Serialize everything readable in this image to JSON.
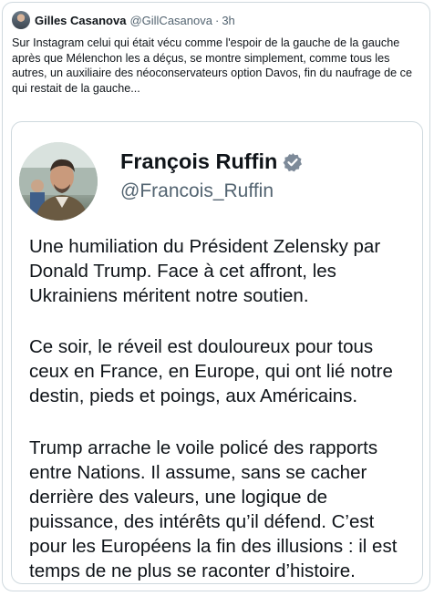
{
  "tweet": {
    "author": {
      "name": "Gilles Casanova",
      "handle": "@GillCasanova",
      "separator": "·",
      "time": "3h"
    },
    "text_lines": [
      "Sur Instagram celui qui était vécu comme l'espoir de la gauche de la gauche",
      "après que Mélenchon les a déçus, se montre simplement, comme tous les",
      "autres, un auxiliaire des néoconservateurs option Davos, fin du naufrage de ce",
      "qui restait de la gauche..."
    ]
  },
  "embedded_post": {
    "name": "François Ruffin",
    "handle": "@Francois_Ruffin",
    "verified_color": "#7d8a99",
    "paragraphs": [
      {
        "lines": [
          "Une humiliation du Président Zelensky par",
          "Donald Trump. Face à cet affront, les",
          "Ukrainiens méritent notre soutien."
        ]
      },
      {
        "lines": [
          "Ce soir, le réveil est douloureux pour tous",
          "ceux en France, en Europe, qui ont lié notre",
          "destin, pieds et poings, aux Américains."
        ]
      },
      {
        "lines": [
          "Trump arrache le voile policé des rapports",
          "entre Nations. Il assume, sans se cacher",
          "derrière des valeurs, une logique de",
          "puissance, des intérêts qu’il défend. C’est",
          "pour les Européens la fin des illusions : il est",
          "temps de ne plus se raconter d’histoire."
        ]
      }
    ]
  }
}
